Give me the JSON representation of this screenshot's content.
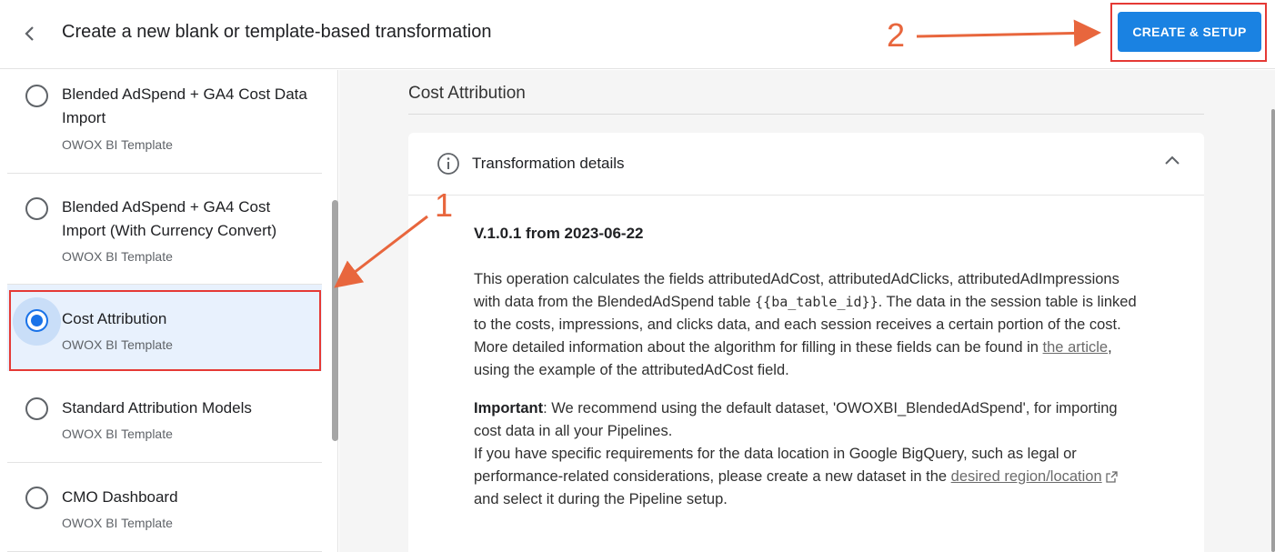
{
  "header": {
    "title": "Create a new blank or template-based transformation",
    "create_button_label": "CREATE & SETUP"
  },
  "annotations": {
    "step1": "1",
    "step2": "2"
  },
  "templates": [
    {
      "name": "Blended AdSpend + GA4 Cost Data Import",
      "subtitle": "OWOX BI Template",
      "selected": false
    },
    {
      "name": "Blended AdSpend + GA4 Cost Import (With Currency Convert)",
      "subtitle": "OWOX BI Template",
      "selected": false
    },
    {
      "name": "Cost Attribution",
      "subtitle": "OWOX BI Template",
      "selected": true
    },
    {
      "name": "Standard Attribution Models",
      "subtitle": "OWOX BI Template",
      "selected": false
    },
    {
      "name": "CMO Dashboard",
      "subtitle": "OWOX BI Template",
      "selected": false
    }
  ],
  "main": {
    "section_title": "Cost Attribution",
    "card_header": "Transformation details",
    "version": "V.1.0.1 from 2023-06-22",
    "para1": {
      "text_a": "This operation calculates the fields attributedAdCost, attributedAdClicks, attributedAdImpressions with data from the BlendedAdSpend table ",
      "code": "{{ba_table_id}}",
      "text_b": ". The data in the session table is linked to the costs, impressions, and clicks data, and each session receives a certain portion of the cost. More detailed information about the algorithm for filling in these fields can be found in ",
      "link": "the article",
      "text_c": ", using the example of the attributedAdCost field."
    },
    "para2": {
      "important_label": "Important",
      "text_a": ": We recommend using the default dataset, 'OWOXBI_BlendedAdSpend', for importing cost data in all your Pipelines.",
      "text_b": "If you have specific requirements for the data location in Google BigQuery, such as legal or performance-related considerations, please create a new dataset in the ",
      "link": "desired region/location",
      "text_c": " and select it during the Pipeline setup."
    }
  },
  "colors": {
    "accent": "#1a82e2",
    "annotation": "#e8663d",
    "highlight_border": "#e53935"
  },
  "icons": [
    "chevron-left-icon",
    "info-icon",
    "chevron-up-icon",
    "external-link-icon"
  ]
}
